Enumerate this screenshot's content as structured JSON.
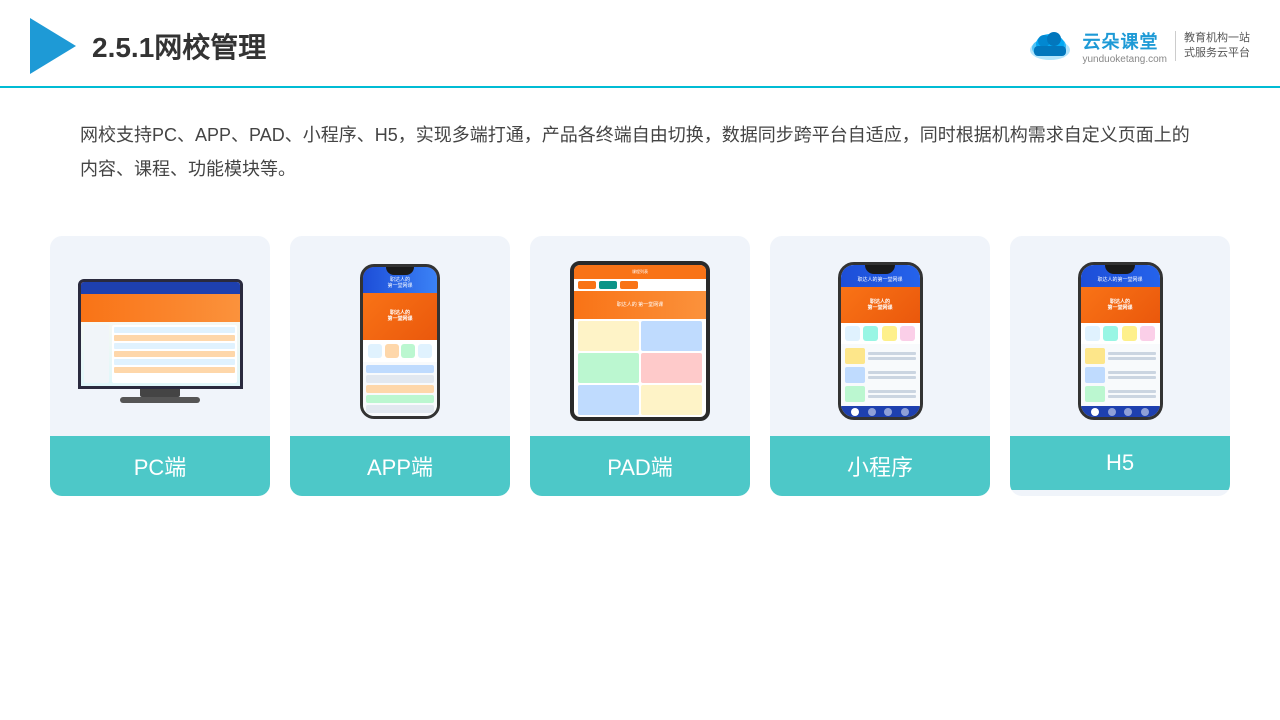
{
  "header": {
    "title": "2.5.1网校管理",
    "brand": {
      "name": "云朵课堂",
      "url": "yunduoketang.com",
      "slogan": "教育机构一站\n式服务云平台"
    }
  },
  "description": "网校支持PC、APP、PAD、小程序、H5，实现多端打通，产品各终端自由切换，数据同步跨平台自适应，同时根据机构需求自定义页面上的内容、课程、功能模块等。",
  "cards": [
    {
      "id": "pc",
      "label": "PC端"
    },
    {
      "id": "app",
      "label": "APP端"
    },
    {
      "id": "pad",
      "label": "PAD端"
    },
    {
      "id": "miniapp",
      "label": "小程序"
    },
    {
      "id": "h5",
      "label": "H5"
    }
  ],
  "colors": {
    "accent": "#4dc8c8",
    "header_line": "#00bcd4",
    "brand_blue": "#1e9ad6",
    "card_bg": "#f0f4fa"
  }
}
